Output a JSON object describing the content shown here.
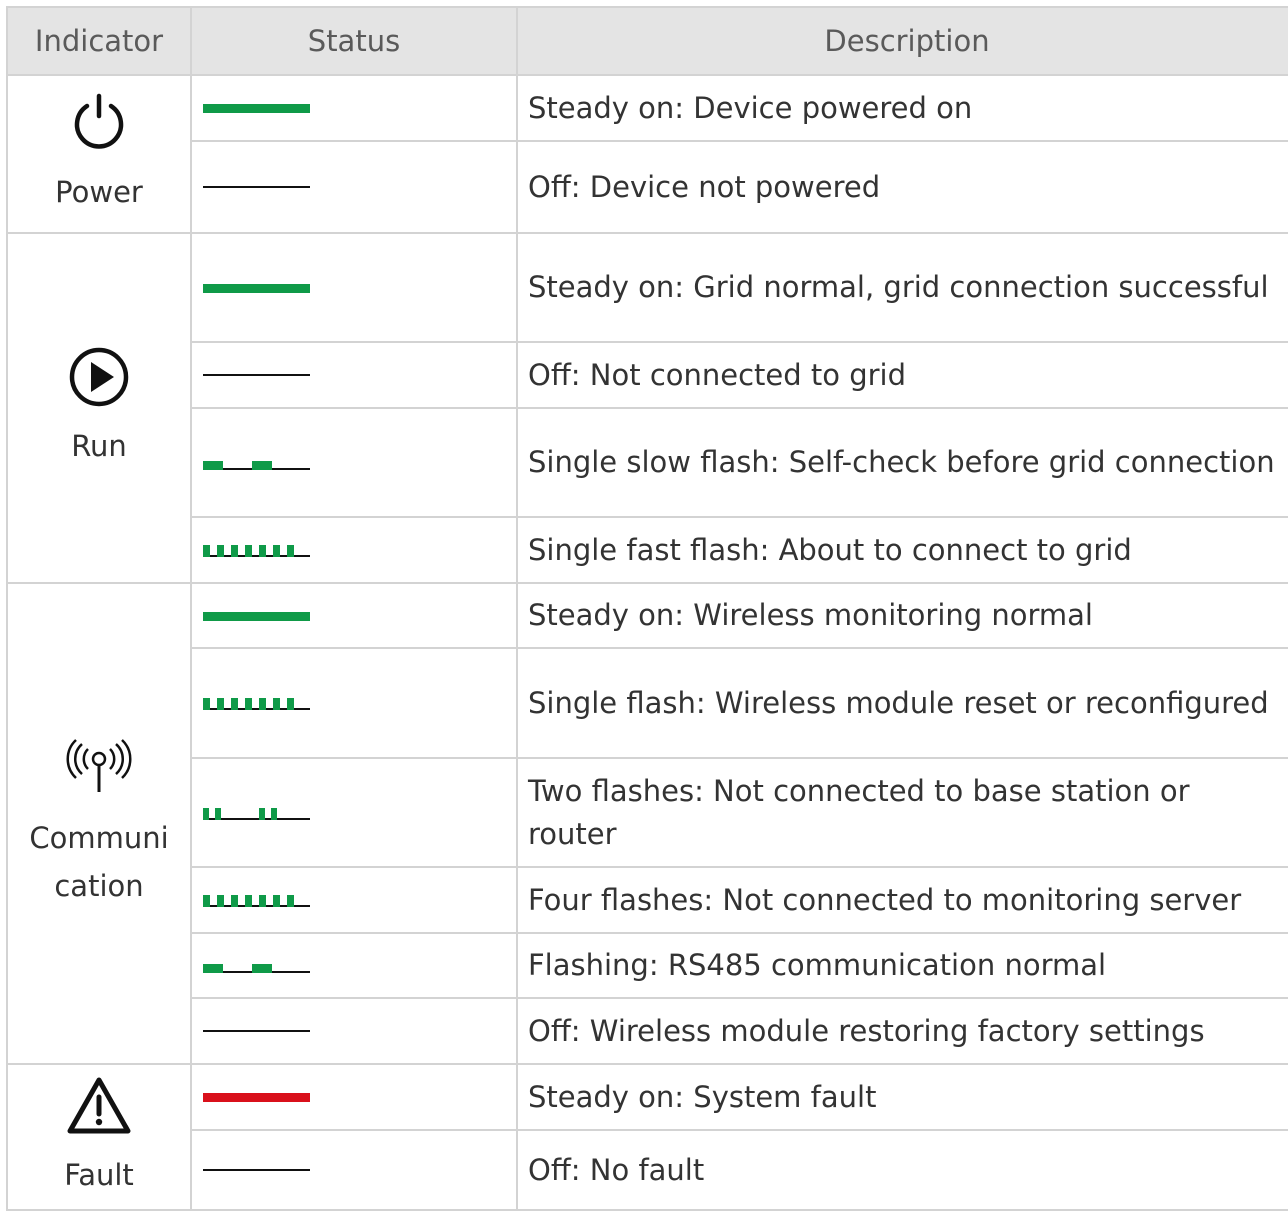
{
  "headers": {
    "indicator": "Indicator",
    "status": "Status",
    "description": "Description"
  },
  "groups": {
    "power": {
      "label": "Power",
      "rows": [
        {
          "status": "solid-green",
          "desc": "Steady on: Device powered on"
        },
        {
          "status": "off",
          "desc": "Off: Device not powered"
        }
      ]
    },
    "run": {
      "label": "Run",
      "rows": [
        {
          "status": "solid-green",
          "desc": "Steady on: Grid normal, grid connection successful"
        },
        {
          "status": "off",
          "desc": "Off: Not connected to grid"
        },
        {
          "status": "slow-flash",
          "desc": "Single slow flash: Self-check before grid connection"
        },
        {
          "status": "fast-flash",
          "desc": "Single fast flash: About to connect to grid"
        }
      ]
    },
    "communication": {
      "label": "Communi cation",
      "rows": [
        {
          "status": "solid-green",
          "desc": "Steady on: Wireless monitoring normal"
        },
        {
          "status": "fast-flash",
          "desc": "Single flash: Wireless module reset or reconfigured"
        },
        {
          "status": "two-flash",
          "desc": "Two flashes: Not connected to base station or router"
        },
        {
          "status": "fast-flash",
          "desc": "Four flashes: Not connected to monitoring server"
        },
        {
          "status": "slow-flash",
          "desc": "Flashing: RS485 communication normal"
        },
        {
          "status": "off",
          "desc": "Off: Wireless module restoring factory settings"
        }
      ]
    },
    "fault": {
      "label": "Fault",
      "rows": [
        {
          "status": "solid-red",
          "desc": "Steady on: System fault"
        },
        {
          "status": "off",
          "desc": "Off: No fault"
        }
      ]
    }
  },
  "icons": {
    "power": "power-icon",
    "run": "play-circle-icon",
    "communication": "wireless-signal-icon",
    "fault": "warning-triangle-icon"
  },
  "colors": {
    "green": "#0f9a48",
    "red": "#d9101b",
    "header_bg": "#e4e4e4",
    "border": "#d3d3d3"
  }
}
